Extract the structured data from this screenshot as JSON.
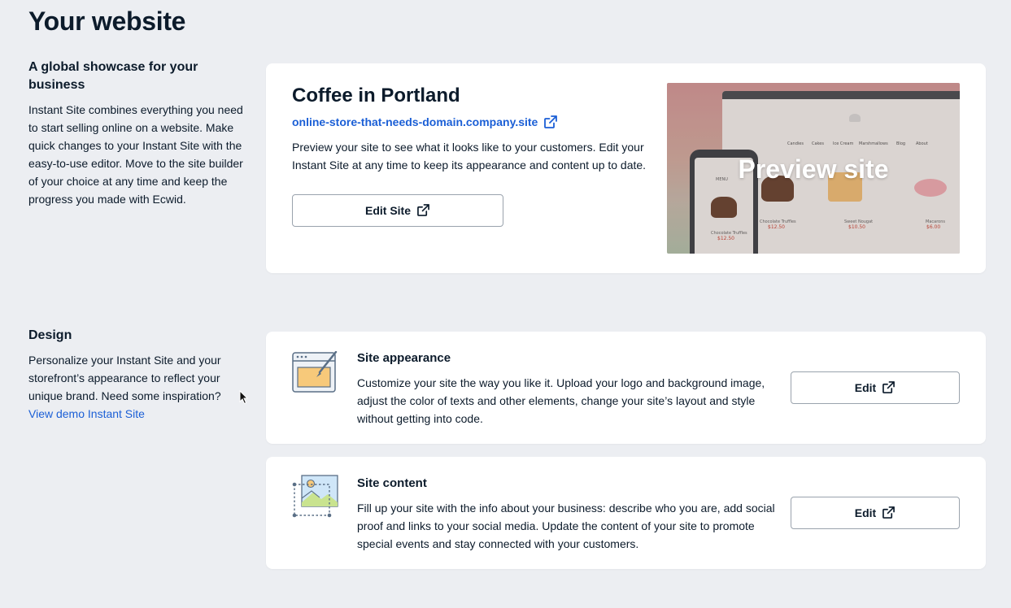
{
  "page": {
    "title": "Your website"
  },
  "showcase": {
    "heading": "A global showcase for your business",
    "text": "Instant Site combines everything you need to start selling online on a website. Make quick changes to your Instant Site with the easy-to-use editor. Move to the site builder of your choice at any time and keep the progress you made with Ecwid."
  },
  "site_card": {
    "title": "Coffee in Portland",
    "url": "online-store-that-needs-domain.company.site",
    "description": "Preview your site to see what it looks like to your customers. Edit your Instant Site at any time to keep its appearance and content up to date.",
    "edit_button": "Edit Site",
    "preview_label": "Preview site",
    "preview_nav": [
      "Candies",
      "Cakes",
      "Ice Cream",
      "Marshmallows",
      "Blog",
      "About"
    ],
    "preview_products": [
      {
        "name": "Chocolate Truffles",
        "price": "$12.50"
      },
      {
        "name": "Sweet Nougat",
        "price": "$10.50"
      },
      {
        "name": "Macarons",
        "price": "$6.00"
      }
    ],
    "preview_phone_menu": "MENU",
    "preview_phone_product": {
      "name": "Chocolate Truffles",
      "price": "$12.50"
    }
  },
  "design": {
    "heading": "Design",
    "text": "Personalize your Instant Site and your storefront’s appearance to reflect your unique brand. Need some inspiration?",
    "link": "View demo Instant Site"
  },
  "appearance": {
    "title": "Site appearance",
    "description": "Customize your site the way you like it. Upload your logo and background image, adjust the color of texts and other elements, change your site’s layout and style without getting into code.",
    "button": "Edit",
    "icon": "browser-brush-icon"
  },
  "content": {
    "title": "Site content",
    "description": "Fill up your site with the info about your business: describe who you are, add social proof and links to your social media. Update the content of your site to promote special events and stay connected with your customers.",
    "button": "Edit",
    "icon": "image-frame-icon"
  },
  "colors": {
    "link": "#1b5fd6",
    "background": "#eceef2",
    "text": "#0c1b2b"
  }
}
